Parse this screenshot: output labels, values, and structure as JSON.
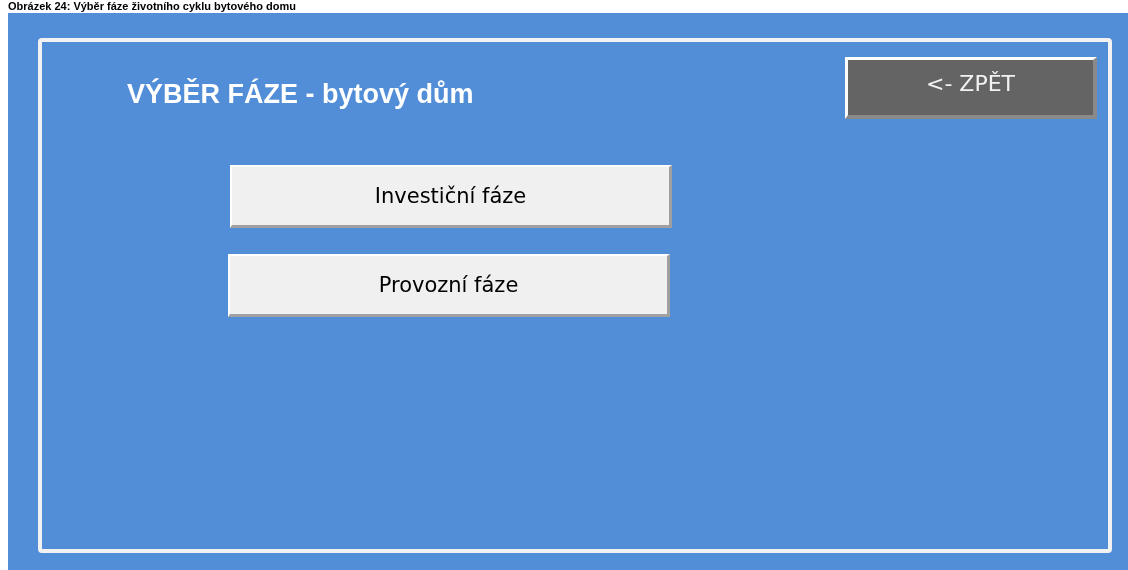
{
  "caption": "Obrázek 24: Výběr fáze životního cyklu bytového domu",
  "title": "VÝBĚR FÁZE - bytový dům",
  "back_button": "<- ZPĚT",
  "buttons": [
    "Investiční fáze",
    "Provozní fáze"
  ]
}
